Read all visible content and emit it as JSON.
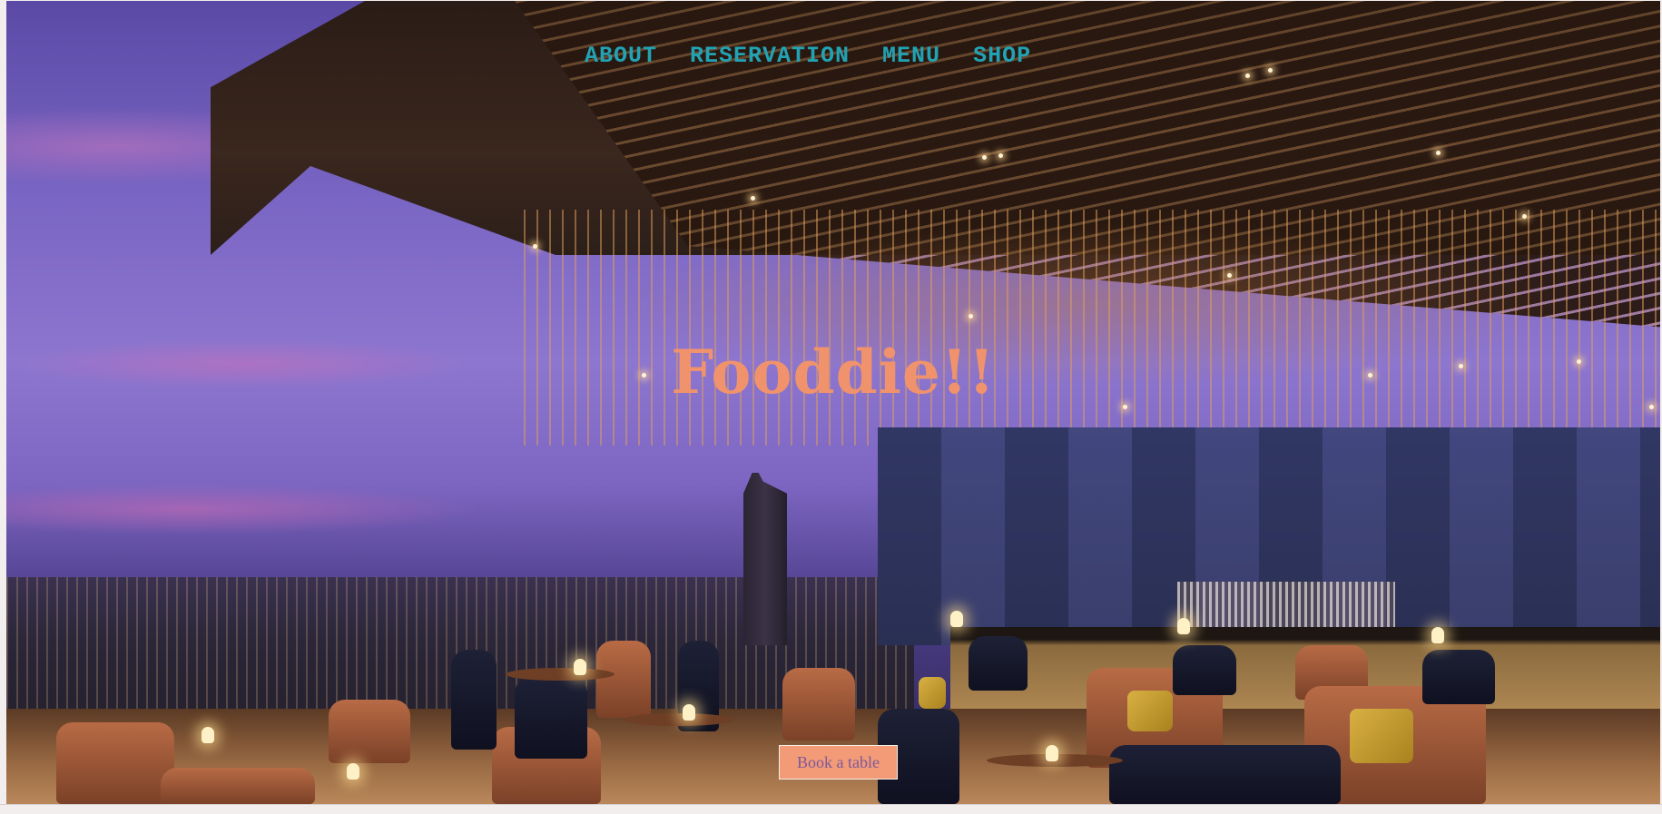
{
  "nav": {
    "items": [
      {
        "label": "ABOUT"
      },
      {
        "label": "RESERVATION"
      },
      {
        "label": "MENU"
      },
      {
        "label": "SHOP"
      }
    ],
    "color": "#21a3b4"
  },
  "hero": {
    "title": "Fooddie!!",
    "title_color": "#f0936c",
    "background_image": "rooftop-restaurant-dusk-photo",
    "cta_label": "Book a table",
    "cta_color": "#f39a77"
  }
}
